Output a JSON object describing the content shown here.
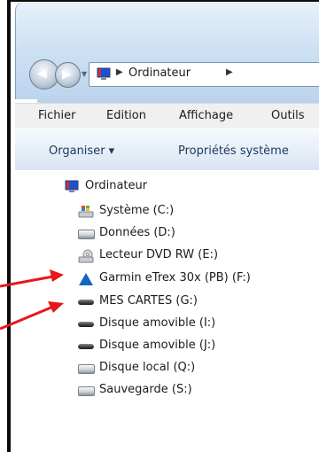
{
  "address_bar": {
    "crumb": "Ordinateur"
  },
  "menu": [
    "Fichier",
    "Edition",
    "Affichage",
    "Outils"
  ],
  "command_bar": {
    "organize": "Organiser ▾",
    "system_props": "Propriétés système"
  },
  "tree": {
    "root": "Ordinateur",
    "items": [
      {
        "label": "Système (C:)",
        "icon": "windows-drive-icon"
      },
      {
        "label": "Données (D:)",
        "icon": "hard-drive-icon"
      },
      {
        "label": "Lecteur DVD RW (E:)",
        "icon": "dvd-drive-icon"
      },
      {
        "label": "Garmin eTrex 30x (PB) (F:)",
        "icon": "garmin-triangle-icon"
      },
      {
        "label": "MES CARTES (G:)",
        "icon": "removable-drive-icon"
      },
      {
        "label": "Disque amovible (I:)",
        "icon": "removable-drive-icon"
      },
      {
        "label": "Disque amovible (J:)",
        "icon": "removable-drive-icon"
      },
      {
        "label": "Disque local (Q:)",
        "icon": "hard-drive-icon"
      },
      {
        "label": "Sauvegarde (S:)",
        "icon": "hard-drive-icon"
      }
    ]
  },
  "colors": {
    "annotation_arrow": "#e8161b",
    "garmin": "#1565c0"
  }
}
